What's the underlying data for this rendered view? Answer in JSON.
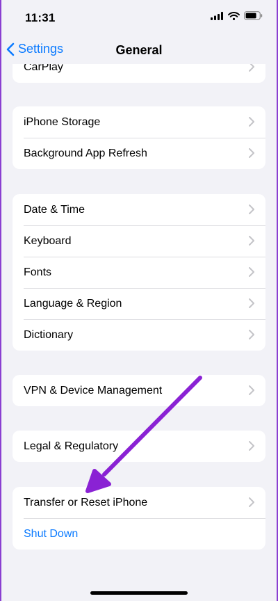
{
  "status": {
    "time": "11:31"
  },
  "nav": {
    "back_label": "Settings",
    "title": "General"
  },
  "groups": [
    {
      "items": [
        "CarPlay"
      ]
    },
    {
      "items": [
        "iPhone Storage",
        "Background App Refresh"
      ]
    },
    {
      "items": [
        "Date & Time",
        "Keyboard",
        "Fonts",
        "Language & Region",
        "Dictionary"
      ]
    },
    {
      "items": [
        "VPN & Device Management"
      ]
    },
    {
      "items": [
        "Legal & Regulatory"
      ]
    },
    {
      "items": [
        "Transfer or Reset iPhone",
        "Shut Down"
      ]
    }
  ],
  "colors": {
    "accent": "#0a7aff",
    "annotation_arrow": "#8a22d4",
    "background": "#f2f2f7"
  },
  "icons": [
    "signal-icon",
    "wifi-icon",
    "battery-icon",
    "chevron-left-icon",
    "chevron-right-icon",
    "annotation-arrow"
  ]
}
